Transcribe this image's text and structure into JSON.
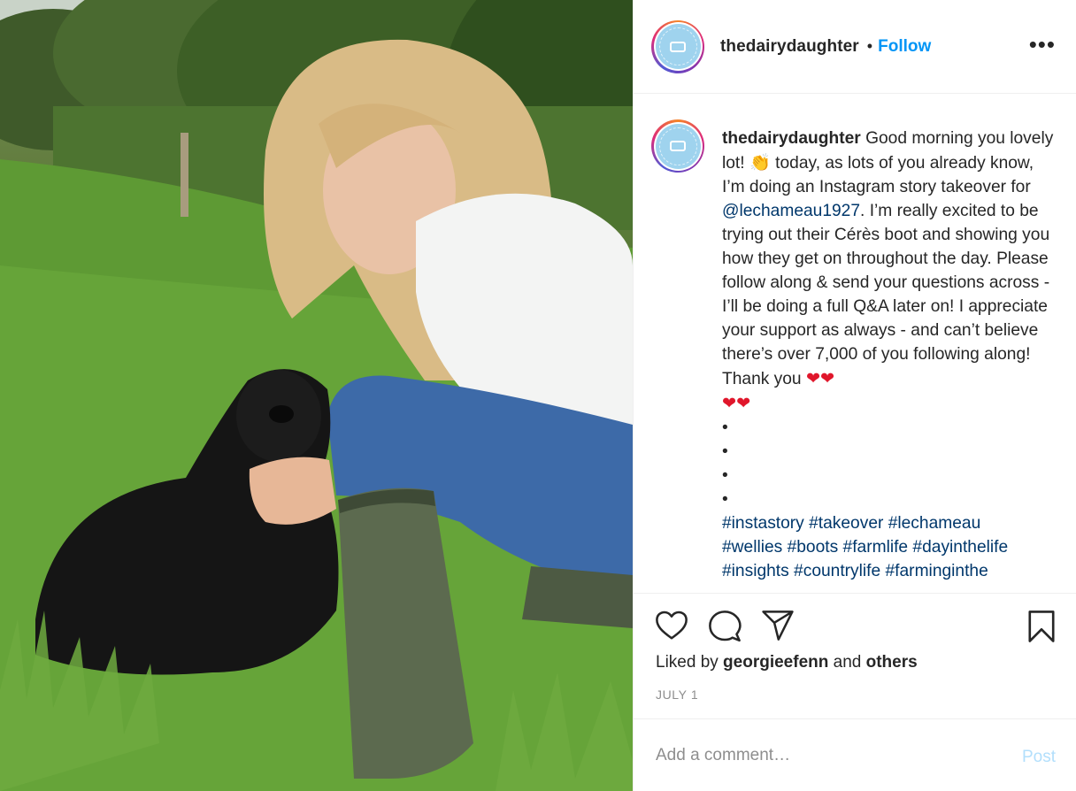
{
  "post": {
    "username": "thedairydaughter",
    "separator": "•",
    "follow_label": "Follow",
    "more_label": "•••",
    "avatar_icon": "dairy-daughter-logo-icon"
  },
  "caption": {
    "username": "thedairydaughter",
    "text_1": " Good morning you lovely lot! ",
    "wave_emoji": "👏",
    "text_2": " today, as lots of you already know, I’m doing an Instagram story takeover for ",
    "mention": "@lechameau1927",
    "text_3": ". I’m really excited to be trying out their Cérès boot and showing you how they get on throughout the day. Please follow along & send your questions across - I’ll be doing a full Q&A later on! I appreciate your support as always - and can’t believe there’s over 7,000 of you following along! Thank you ",
    "hearts": "❤❤",
    "hearts_2": "❤❤",
    "bullets": [
      "•",
      "•",
      "•",
      "•"
    ],
    "hashtags_line1": "#instastory #takeover #lechameau",
    "hashtags_line2": "#wellies #boots #farmlife #dayinthelife",
    "hashtags_line3": "#insights #countrylife #farminginthe"
  },
  "actions": {
    "like_icon": "heart-icon",
    "comment_icon": "comment-icon",
    "share_icon": "share-icon",
    "save_icon": "bookmark-icon"
  },
  "likes": {
    "prefix": "Liked by ",
    "user": "georgieefenn",
    "middle": " and ",
    "others": "others"
  },
  "date": "JULY 1",
  "comment_box": {
    "placeholder": "Add a comment…",
    "post_label": "Post"
  },
  "colors": {
    "follow_blue": "#0095f6",
    "link_blue": "#00376b",
    "post_disabled": "#b2dffc",
    "heart_red": "#e0162b"
  }
}
